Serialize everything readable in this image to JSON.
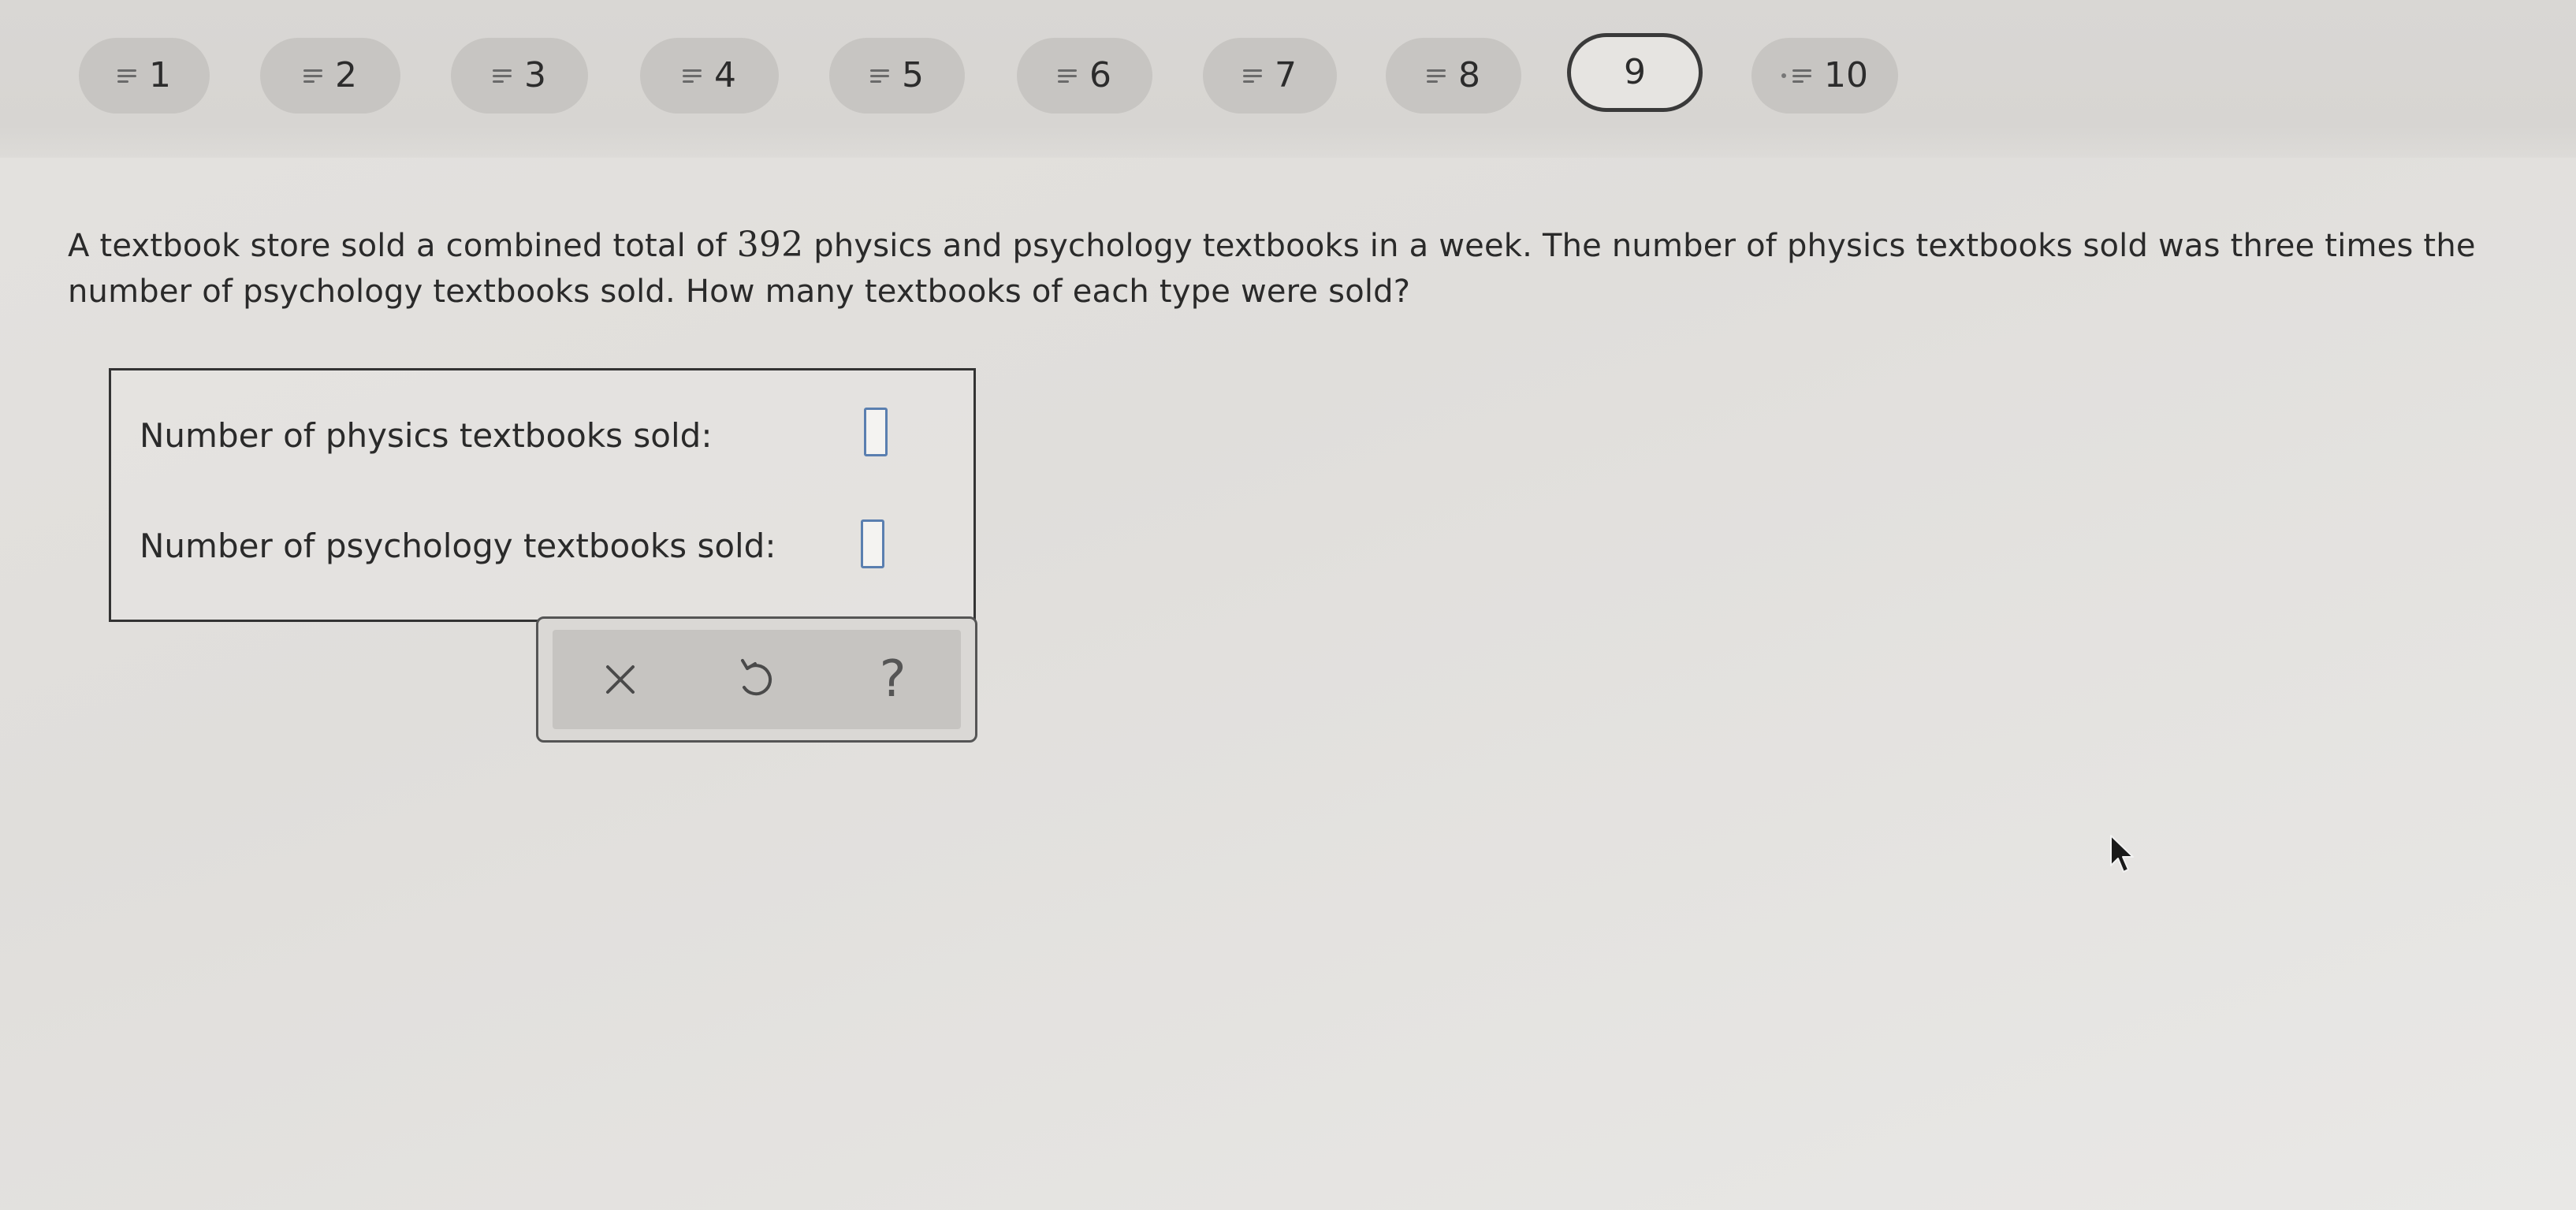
{
  "nav": {
    "questions": [
      {
        "label": "1",
        "state": "answered"
      },
      {
        "label": "2",
        "state": "answered"
      },
      {
        "label": "3",
        "state": "answered"
      },
      {
        "label": "4",
        "state": "answered"
      },
      {
        "label": "5",
        "state": "answered"
      },
      {
        "label": "6",
        "state": "answered"
      },
      {
        "label": "7",
        "state": "answered"
      },
      {
        "label": "8",
        "state": "answered"
      },
      {
        "label": "9",
        "state": "current"
      },
      {
        "label": "10",
        "state": "answered"
      }
    ]
  },
  "problem": {
    "text_before": "A textbook store sold a combined total of ",
    "total": "392",
    "text_after": " physics and psychology textbooks in a week. The number of physics textbooks sold was three times the number of psychology textbooks sold. How many textbooks of each type were sold?"
  },
  "answers": {
    "physics_label": "Number of physics textbooks sold:",
    "physics_value": "",
    "psychology_label": "Number of psychology textbooks sold:",
    "psychology_value": ""
  },
  "tools": {
    "clear_icon": "x-icon",
    "undo_icon": "undo-icon",
    "help_label": "?"
  },
  "colors": {
    "input_border": "#5a7fb0",
    "current_border": "#3a3a3a"
  }
}
